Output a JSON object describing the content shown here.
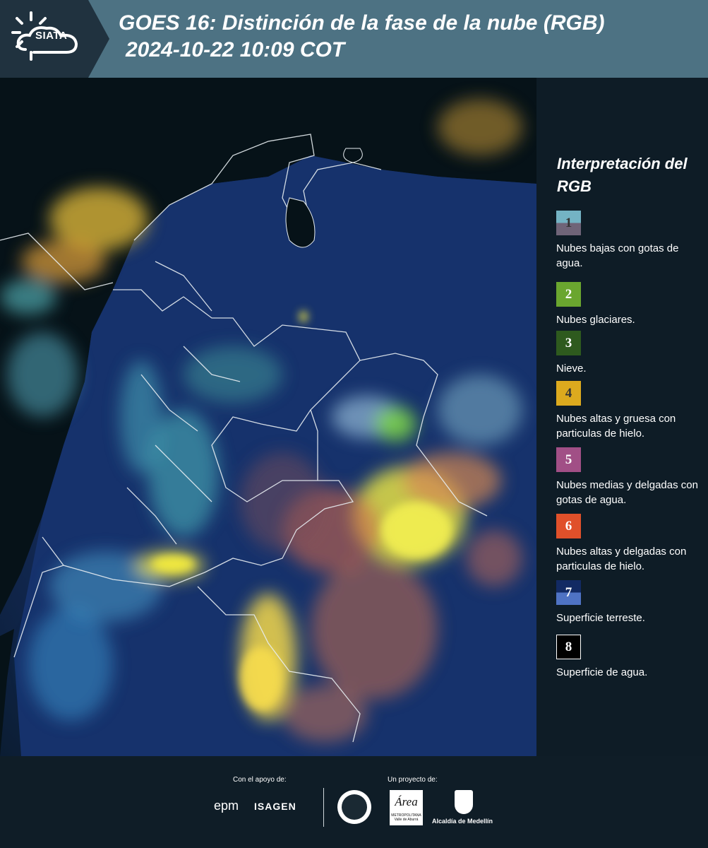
{
  "header": {
    "logo_text": "SIATA",
    "title": "GOES 16: Distinción de la fase de la nube (RGB)",
    "subtitle": "2024-10-22 10:09 COT"
  },
  "legend": {
    "title": "Interpretación del RGB",
    "items": [
      {
        "number": "1",
        "label": "Nubes bajas con gotas de agua.",
        "color_top": "#74b3c4",
        "color_bottom": "#6f6478",
        "number_color": "#333333"
      },
      {
        "number": "2",
        "label": "Nubes glaciares.",
        "color_top": "#6aa62f",
        "color_bottom": "#6aa62f",
        "number_color": "#ffffff"
      },
      {
        "number": "3",
        "label": "Nieve.",
        "color_top": "#2e5a1e",
        "color_bottom": "#2e5a1e",
        "number_color": "#ffffff"
      },
      {
        "number": "4",
        "label": "Nubes altas y gruesa con particulas de hielo.",
        "color_top": "#dcaa1e",
        "color_bottom": "#dcaa1e",
        "number_color": "#333333"
      },
      {
        "number": "5",
        "label": "Nubes medias y delgadas con gotas de agua.",
        "color_top": "#a14f86",
        "color_bottom": "#a14f86",
        "number_color": "#ffffff"
      },
      {
        "number": "6",
        "label": "Nubes altas y delgadas con particulas de hielo.",
        "color_top": "#e0502a",
        "color_bottom": "#e0502a",
        "number_color": "#ffffff"
      },
      {
        "number": "7",
        "label": "Superficie terreste.",
        "color_top": "#122a63",
        "color_bottom": "#4f73c4",
        "number_color": "#ffffff"
      },
      {
        "number": "8",
        "label": "Superficie de agua.",
        "color_top": "#000000",
        "color_bottom": "#000000",
        "number_color": "#ffffff"
      }
    ]
  },
  "footer": {
    "support_label": "Con el apoyo de:",
    "project_label": "Un proyecto de:",
    "sponsor_1": "epm",
    "sponsor_2": "ISAGEN",
    "amva_logo": "Área",
    "amva_sub": "METROPOLITANA Valle de Aburrá",
    "medellin_label": "Alcaldía de Medellín"
  }
}
